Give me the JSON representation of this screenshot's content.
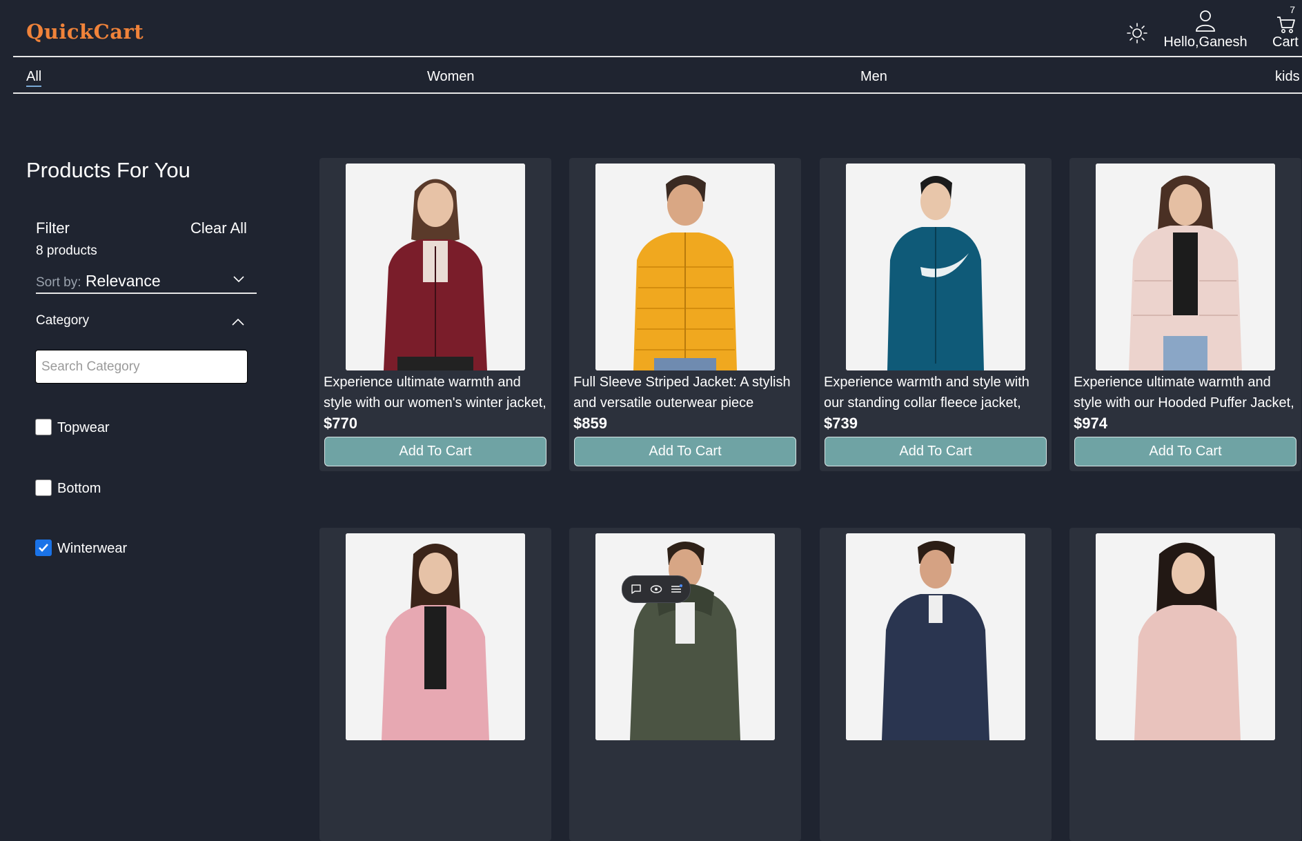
{
  "header": {
    "logo": "QuickCart",
    "greeting": "Hello,Ganesh",
    "cart_label": "Cart",
    "cart_count": "7"
  },
  "nav": {
    "items": [
      {
        "label": "All",
        "active": true
      },
      {
        "label": "Women",
        "active": false
      },
      {
        "label": "Men",
        "active": false
      },
      {
        "label": "kids",
        "active": false
      }
    ]
  },
  "sidebar": {
    "title": "Products For You",
    "filter_label": "Filter",
    "clear_all": "Clear All",
    "count_text": "8 products",
    "sort_label": "Sort by:",
    "sort_value": "Relevance",
    "category_label": "Category",
    "search_placeholder": "Search Category",
    "categories": [
      {
        "label": "Topwear",
        "checked": false
      },
      {
        "label": "Bottom",
        "checked": false
      },
      {
        "label": "Winterwear",
        "checked": true
      }
    ]
  },
  "products": [
    {
      "description": "Experience ultimate warmth and style with our women's winter jacket,",
      "price": "$770",
      "button": "Add To Cart",
      "image": "woman-maroon-fleece-jacket"
    },
    {
      "description": "Full Sleeve Striped Jacket: A stylish and versatile outerwear piece",
      "price": "$859",
      "button": "Add To Cart",
      "image": "man-yellow-puffer-jacket"
    },
    {
      "description": "Experience warmth and style with our standing collar fleece jacket,",
      "price": "$739",
      "button": "Add To Cart",
      "image": "woman-teal-track-jacket"
    },
    {
      "description": "Experience ultimate warmth and style with our Hooded Puffer Jacket,",
      "price": "$974",
      "button": "Add To Cart",
      "image": "woman-pink-hooded-puffer"
    },
    {
      "description": "",
      "price": "",
      "button": "",
      "image": "woman-pink-bomber-jacket"
    },
    {
      "description": "",
      "price": "",
      "button": "",
      "image": "man-olive-hooded-puffer"
    },
    {
      "description": "",
      "price": "",
      "button": "",
      "image": "man-navy-jacket"
    },
    {
      "description": "",
      "price": "",
      "button": "",
      "image": "woman-blush-bomber-jacket"
    }
  ],
  "colors": {
    "background": "#1f2430",
    "card": "#2c313c",
    "logo": "#f0833a",
    "button": "#6fa3a4",
    "checkbox_checked": "#1a73e8"
  },
  "floating_toolbar": {
    "icons": [
      "comment-icon",
      "eye-icon",
      "list-icon"
    ]
  }
}
